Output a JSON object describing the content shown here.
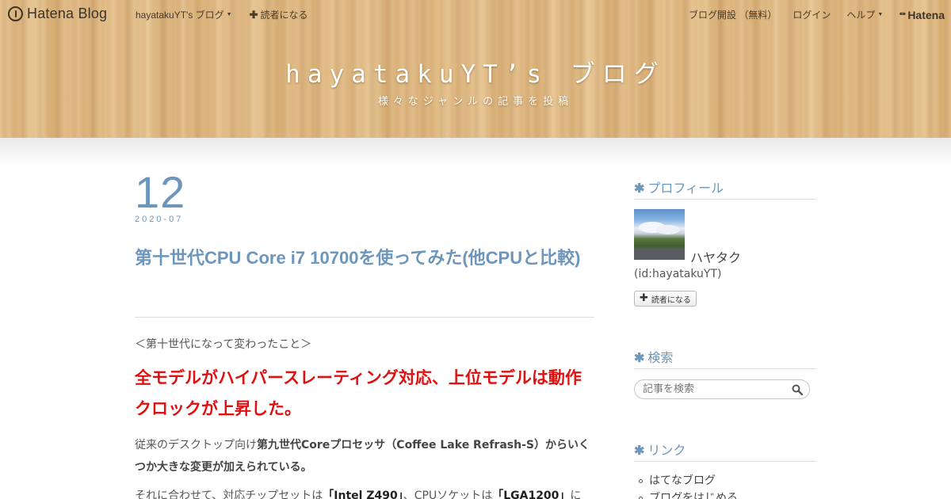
{
  "topbar": {
    "logo_text": "Hatena Blog",
    "blog_menu": "hayatakuYT's ブログ",
    "subscribe": "読者になる",
    "open_blog": "ブログ開設 （無料）",
    "login": "ログイン",
    "help": "ヘルプ",
    "brand": "Hatena"
  },
  "header": {
    "title": "hayatakuYT’s ブログ",
    "description": "様々なジャンルの記事を投稿"
  },
  "entry": {
    "date_day": "12",
    "date_ym": "2020-07",
    "title": "第十世代CPU Core i7 10700を使ってみた(他CPUと比較)",
    "section_heading": "＜第十世代になって変わったこと＞",
    "red_heading": "全モデルがハイパースレーティング対応、上位モデルは動作クロックが上昇した。",
    "para1": {
      "t1": "従来のデスクトップ向け",
      "b1": "第九世代Coreプロセッサ（Coffee Lake Refrash-S）からいくつか大きな変更が加えられている。"
    },
    "para2": {
      "t1": "それに合わせて、対応チップセットは",
      "b1": "「Intel Z490」",
      "t2": "、CPUソケットは",
      "b2": "「LGA1200」",
      "t3": "に"
    }
  },
  "sidebar": {
    "profile_heading": "プロフィール",
    "profile_name": "ハヤタク",
    "profile_id": "(id:hayatakuYT)",
    "reader_button": "読者になる",
    "search_heading": "検索",
    "search_placeholder": "記事を検索",
    "links_heading": "リンク",
    "links": [
      "はてなブログ",
      "ブログをはじめる"
    ]
  },
  "colors": {
    "accent": "#6c96bb",
    "headline_red": "#e11010"
  }
}
